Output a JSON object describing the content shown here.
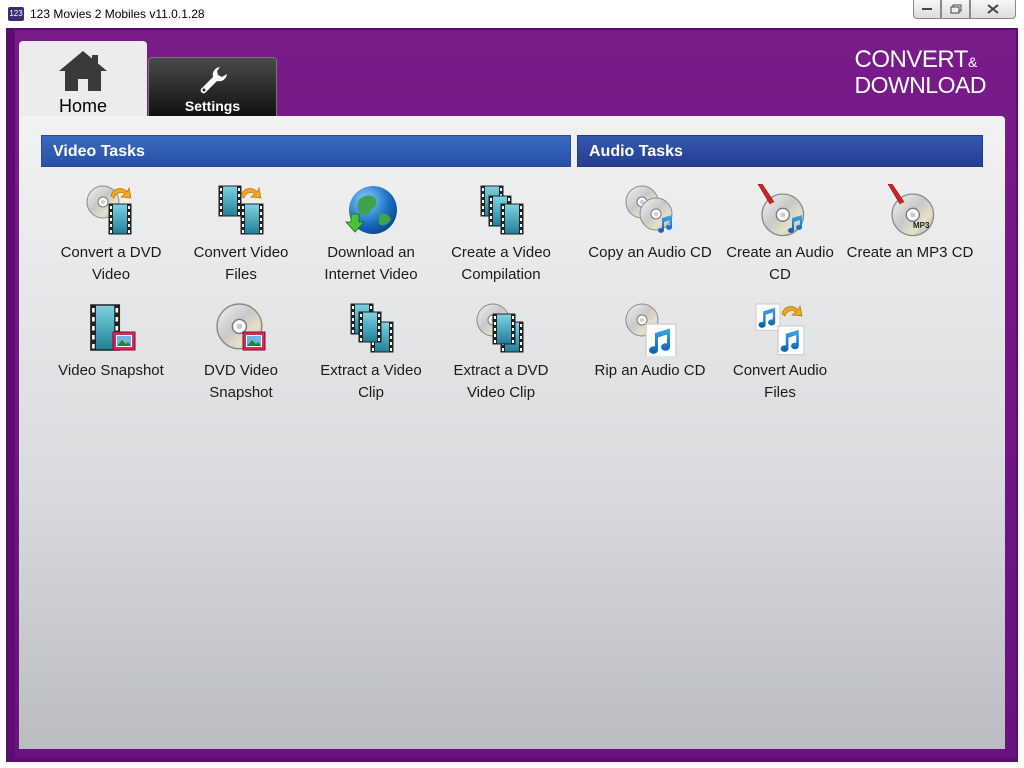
{
  "window": {
    "title": "123 Movies 2 Mobiles v11.0.1.28",
    "app_icon_text": "123"
  },
  "logo": {
    "line1": "CONVERT",
    "ampersand": "&",
    "line2": "DOWNLOAD"
  },
  "tabs": [
    {
      "label": "Home",
      "icon": "house-icon",
      "selected": true
    },
    {
      "label": "Settings",
      "icon": "wrench-icon",
      "selected": false
    }
  ],
  "sections": {
    "video": {
      "title": "Video Tasks"
    },
    "audio": {
      "title": "Audio Tasks"
    }
  },
  "video_tasks": [
    {
      "label": "Convert a DVD Video",
      "icon": "dvd-to-film-icon"
    },
    {
      "label": "Convert Video Files",
      "icon": "film-convert-icon"
    },
    {
      "label": "Download an Internet Video",
      "icon": "globe-download-icon"
    },
    {
      "label": "Create a Video Compilation",
      "icon": "film-stack-icon"
    },
    {
      "label": "Video Snapshot",
      "icon": "film-photo-icon"
    },
    {
      "label": "DVD Video Snapshot",
      "icon": "dvd-photo-icon"
    },
    {
      "label": "Extract a Video Clip",
      "icon": "film-extract-icon"
    },
    {
      "label": "Extract a DVD Video Clip",
      "icon": "dvd-film-extract-icon"
    }
  ],
  "audio_tasks": [
    {
      "label": "Copy an Audio CD",
      "icon": "cd-copy-icon"
    },
    {
      "label": "Create an Audio CD",
      "icon": "cd-burn-icon"
    },
    {
      "label": "Create an MP3 CD",
      "icon": "mp3-cd-burn-icon",
      "disc_text": "MP3"
    },
    {
      "label": "Rip an Audio CD",
      "icon": "cd-rip-icon"
    },
    {
      "label": "Convert Audio Files",
      "icon": "audio-convert-icon"
    }
  ],
  "colors": {
    "frame_purple": "#6a1280",
    "video_header": "#2f5fb8",
    "audio_header": "#2a4a9e",
    "film_teal": "#2aa3b8"
  }
}
